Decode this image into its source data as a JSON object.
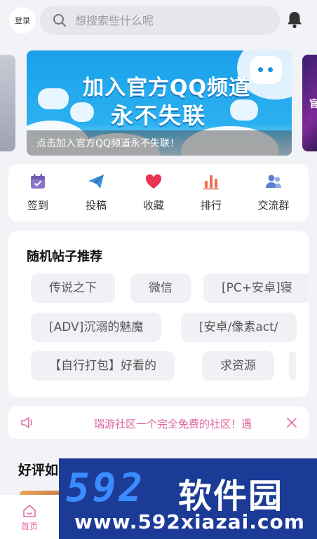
{
  "header": {
    "login_label": "登录",
    "search_placeholder": "想搜索些什么呢"
  },
  "banner": {
    "title_line1": "加入官方QQ频道",
    "title_line2": "永不失联",
    "caption": "点击加入官方QQ频道永不失联！",
    "right_peek_text": "官"
  },
  "actions": [
    {
      "label": "签到",
      "icon": "calendar-icon",
      "color": "#8b76c9"
    },
    {
      "label": "投稿",
      "icon": "paper-plane-icon",
      "color": "#3a8fd6"
    },
    {
      "label": "收藏",
      "icon": "heart-icon",
      "color": "#e8344e"
    },
    {
      "label": "排行",
      "icon": "bar-chart-icon",
      "color": "#ef6b55"
    },
    {
      "label": "交流群",
      "icon": "group-icon",
      "color": "#5a7fd1"
    }
  ],
  "random_posts": {
    "title": "随机帖子推荐",
    "chips": [
      "传说之下",
      "微信",
      "[PC+安卓]寝",
      "[ADV]沉溺的魅魔",
      "[安卓/像素act/",
      "【自行打包】好看的",
      "求资源"
    ]
  },
  "notice": {
    "message": "瑞游社区一个完全免费的社区！遇"
  },
  "good_reviews": {
    "title": "好评如"
  },
  "tabbar": {
    "home_label": "首页"
  },
  "watermark": {
    "brand_number": "592",
    "brand_text": "软件园",
    "url": "www.592xiazai.com"
  },
  "colors": {
    "accent_pink": "#e36aa8",
    "background": "#f2f3f7"
  }
}
